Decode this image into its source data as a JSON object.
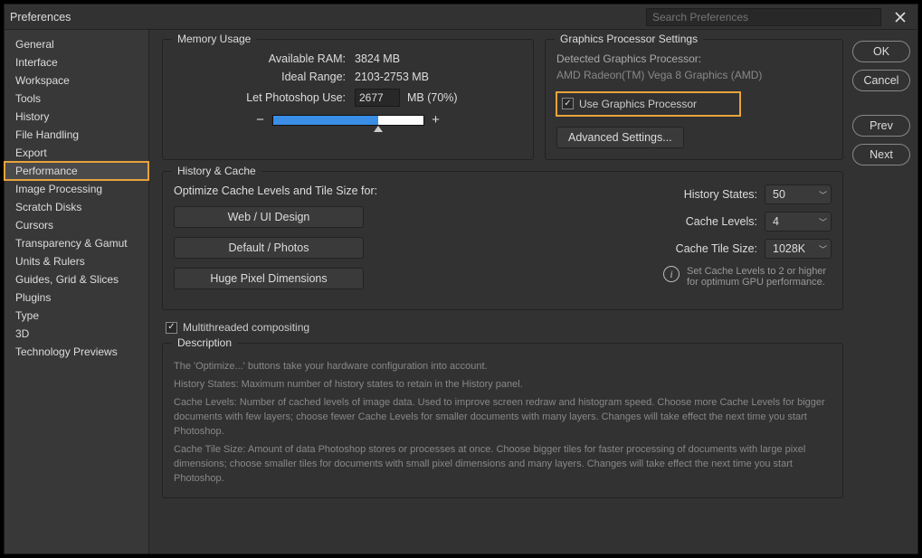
{
  "window": {
    "title": "Preferences",
    "search_placeholder": "Search Preferences"
  },
  "sidebar": {
    "items": [
      "General",
      "Interface",
      "Workspace",
      "Tools",
      "History",
      "File Handling",
      "Export",
      "Performance",
      "Image Processing",
      "Scratch Disks",
      "Cursors",
      "Transparency & Gamut",
      "Units & Rulers",
      "Guides, Grid & Slices",
      "Plugins",
      "Type",
      "3D",
      "Technology Previews"
    ],
    "selected_index": 7
  },
  "buttons": {
    "ok": "OK",
    "cancel": "Cancel",
    "prev": "Prev",
    "next": "Next"
  },
  "memory": {
    "group_title": "Memory Usage",
    "available_label": "Available RAM:",
    "available_value": "3824 MB",
    "ideal_label": "Ideal Range:",
    "ideal_value": "2103-2753 MB",
    "let_use_label": "Let Photoshop Use:",
    "let_use_value": "2677",
    "let_use_suffix": "MB (70%)",
    "minus": "−",
    "plus": "+"
  },
  "gpu": {
    "group_title": "Graphics Processor Settings",
    "detected_label": "Detected Graphics Processor:",
    "detected_name": "AMD Radeon(TM) Vega 8 Graphics (AMD)",
    "use_gpu_label": "Use Graphics Processor",
    "advanced_btn": "Advanced Settings..."
  },
  "history_cache": {
    "group_title": "History & Cache",
    "optimize_label": "Optimize Cache Levels and Tile Size for:",
    "btn_web": "Web / UI Design",
    "btn_default": "Default / Photos",
    "btn_huge": "Huge Pixel Dimensions",
    "history_states_label": "History States:",
    "history_states_value": "50",
    "cache_levels_label": "Cache Levels:",
    "cache_levels_value": "4",
    "cache_tile_label": "Cache Tile Size:",
    "cache_tile_value": "1028K",
    "info_text": "Set Cache Levels to 2 or higher for optimum GPU performance."
  },
  "multithread": {
    "label": "Multithreaded compositing"
  },
  "description": {
    "group_title": "Description",
    "line1": "The 'Optimize...' buttons take your hardware configuration into account.",
    "line2": "History States: Maximum number of history states to retain in the History panel.",
    "line3": "Cache Levels: Number of cached levels of image data.  Used to improve screen redraw and histogram speed.  Choose more Cache Levels for bigger documents with few layers; choose fewer Cache Levels for smaller documents with many layers. Changes will take effect the next time you start Photoshop.",
    "line4": "Cache Tile Size: Amount of data Photoshop stores or processes at once. Choose bigger tiles for faster processing of documents with large pixel dimensions; choose smaller tiles for documents with small pixel dimensions and many layers. Changes will take effect the next time you start Photoshop."
  }
}
